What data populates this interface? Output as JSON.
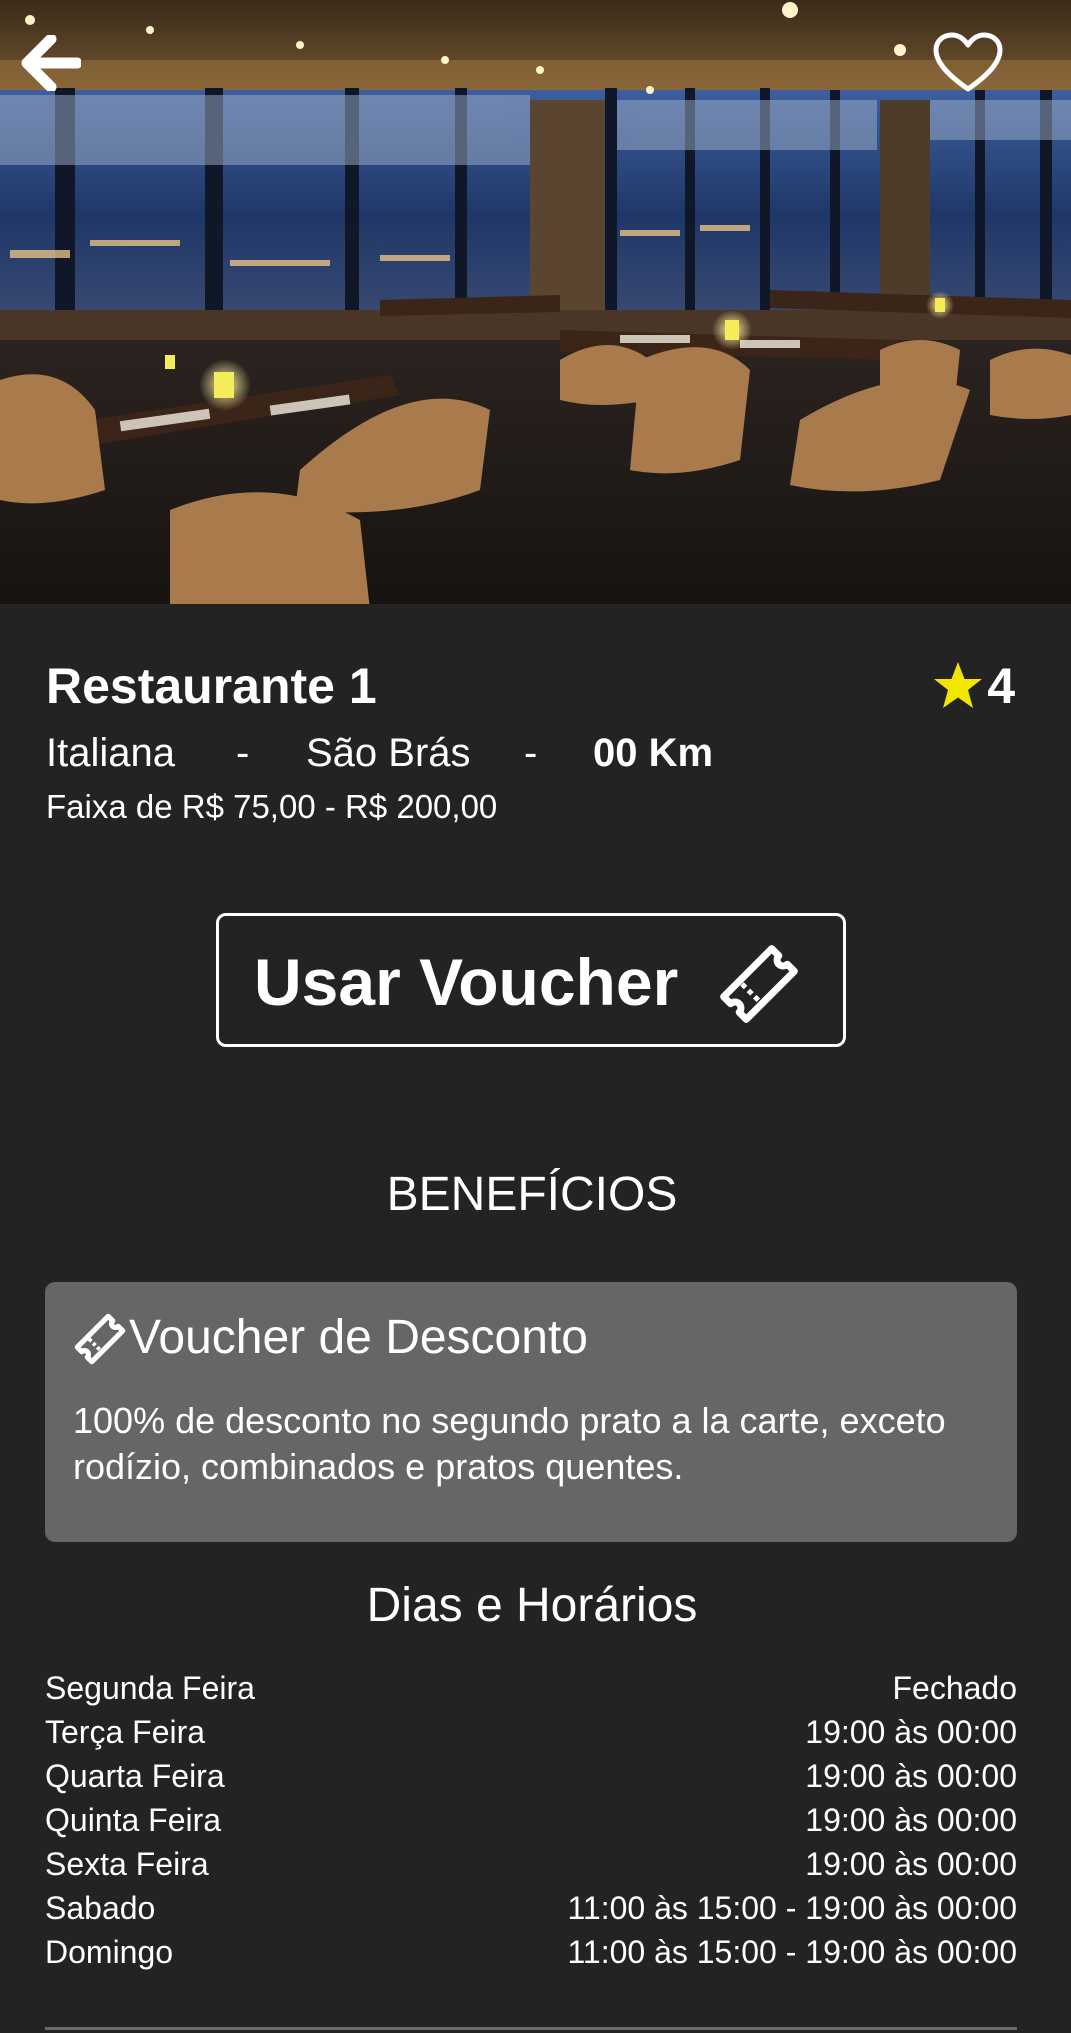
{
  "header": {
    "back_icon": "arrow-left-icon",
    "favorite_icon": "heart-outline-icon"
  },
  "restaurant": {
    "name": "Restaurante 1",
    "rating": "4",
    "rating_icon": "star-icon",
    "cuisine": "Italiana",
    "separator": "-",
    "neighborhood": "São Brás",
    "distance": "00 Km",
    "price_range": "Faixa de R$ 75,00 - R$ 200,00"
  },
  "voucher_button": {
    "label": "Usar Voucher",
    "icon": "ticket-icon"
  },
  "benefits": {
    "section_title": "BENEFÍCIOS",
    "card": {
      "icon": "ticket-icon",
      "title": "Voucher de Desconto",
      "description": "100% de desconto no segundo prato a la carte, exceto rodízio, combinados e pratos quentes."
    }
  },
  "hours": {
    "section_title": "Dias e Horários",
    "rows": [
      {
        "day": "Segunda Feira",
        "time": "Fechado"
      },
      {
        "day": "Terça Feira",
        "time": "19:00 às 00:00"
      },
      {
        "day": "Quarta Feira",
        "time": "19:00 às 00:00"
      },
      {
        "day": "Quinta Feira",
        "time": "19:00 às 00:00"
      },
      {
        "day": "Sexta Feira",
        "time": "19:00 às 00:00"
      },
      {
        "day": "Sabado",
        "time": "11:00 às 15:00 - 19:00 às 00:00"
      },
      {
        "day": "Domingo",
        "time": "11:00 às 15:00 - 19:00 às 00:00"
      }
    ]
  },
  "colors": {
    "background": "#232323",
    "card_background": "#666666",
    "star": "#f2e600",
    "text": "#ffffff"
  }
}
